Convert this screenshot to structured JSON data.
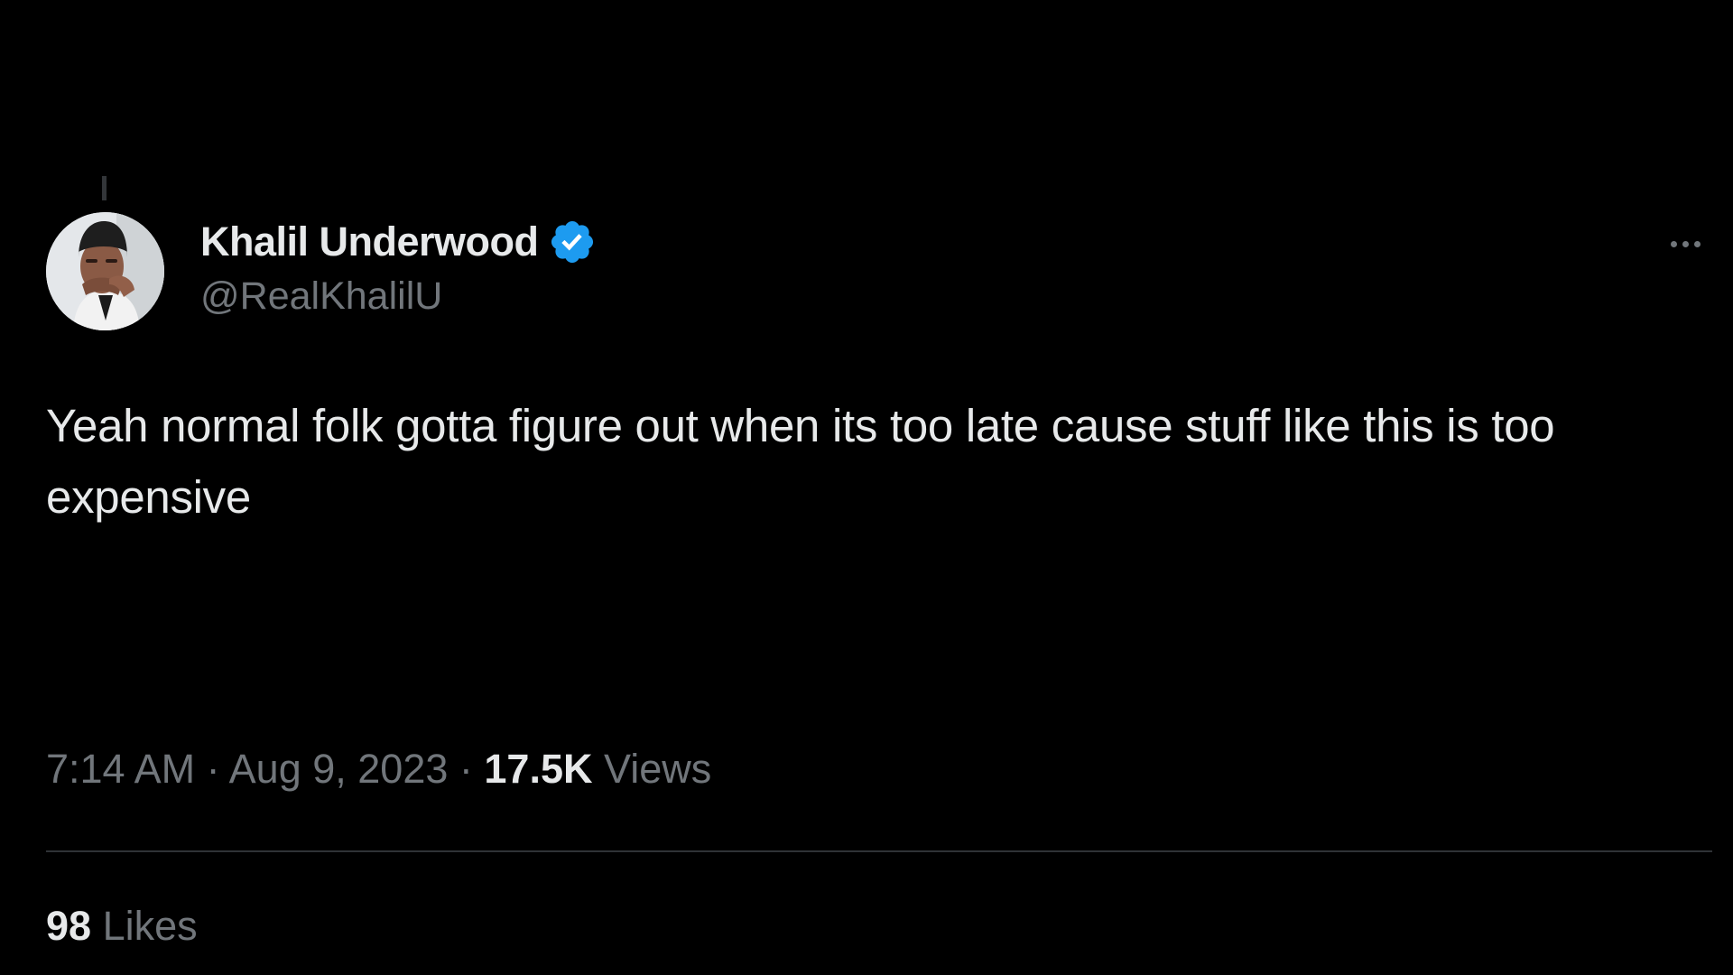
{
  "tweet": {
    "author": {
      "display_name": "Khalil Underwood",
      "handle": "@RealKhalilU",
      "verified": true
    },
    "text": "Yeah normal folk gotta figure out when its too late cause stuff like this is too expensive",
    "time": "7:14 AM",
    "separator": "·",
    "date": "Aug 9, 2023",
    "views_count": "17.5K",
    "views_label": "Views",
    "likes_count": "98",
    "likes_label": "Likes"
  },
  "icons": {
    "verified": "verified-badge-icon",
    "more": "more-options-icon"
  },
  "colors": {
    "background": "#000000",
    "primary_text": "#e7e9ea",
    "secondary_text": "#71767b",
    "verified_blue": "#1d9bf0",
    "divider": "#2f3336"
  }
}
